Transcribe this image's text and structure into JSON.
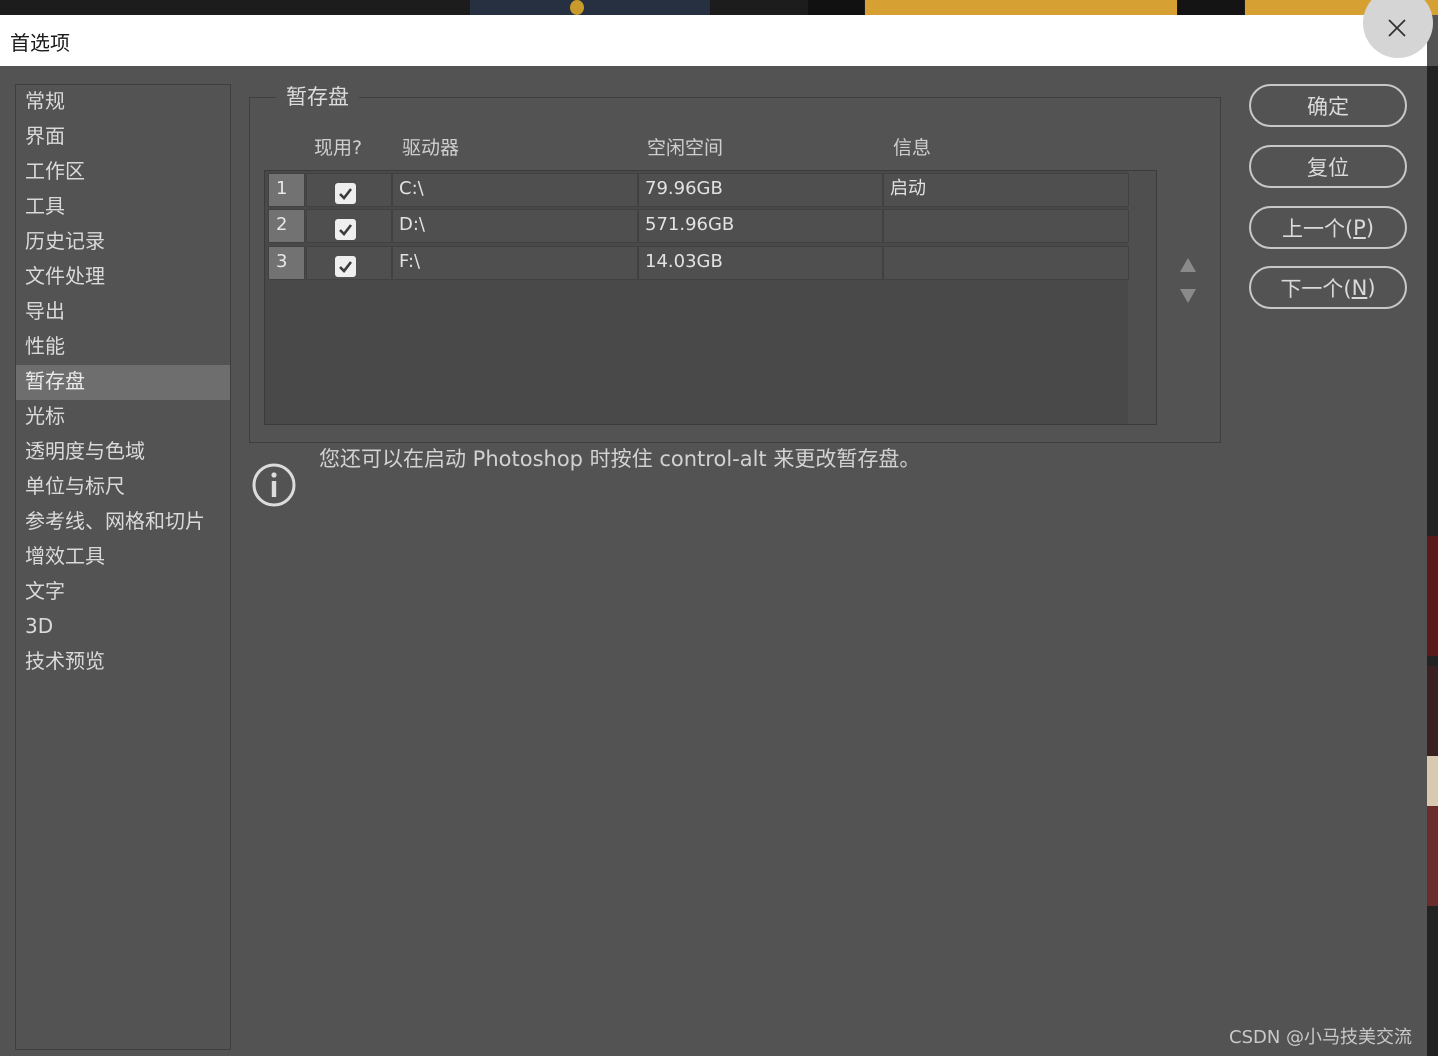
{
  "window": {
    "title": "首选项"
  },
  "sidebar": {
    "items": [
      {
        "label": "常规"
      },
      {
        "label": "界面"
      },
      {
        "label": "工作区"
      },
      {
        "label": "工具"
      },
      {
        "label": "历史记录"
      },
      {
        "label": "文件处理"
      },
      {
        "label": "导出"
      },
      {
        "label": "性能"
      },
      {
        "label": "暂存盘",
        "selected": true
      },
      {
        "label": "光标"
      },
      {
        "label": "透明度与色域"
      },
      {
        "label": "单位与标尺"
      },
      {
        "label": "参考线、网格和切片"
      },
      {
        "label": "增效工具"
      },
      {
        "label": "文字"
      },
      {
        "label": "3D"
      },
      {
        "label": "技术预览"
      }
    ]
  },
  "scratch": {
    "section_title": "暂存盘",
    "columns": {
      "active": "现用?",
      "drive": "驱动器",
      "free": "空闲空间",
      "info": "信息"
    },
    "rows": [
      {
        "num": "1",
        "checked": true,
        "drive": "C:\\",
        "free": "79.96GB",
        "info": "启动"
      },
      {
        "num": "2",
        "checked": true,
        "drive": "D:\\",
        "free": "571.96GB",
        "info": ""
      },
      {
        "num": "3",
        "checked": true,
        "drive": "F:\\",
        "free": "14.03GB",
        "info": ""
      }
    ]
  },
  "info": {
    "text": "您还可以在启动 Photoshop 时按住 control-alt 来更改暂存盘。"
  },
  "buttons": {
    "ok": "确定",
    "reset": "复位",
    "prev_text": "上一个(",
    "prev_key": "P",
    "next_text": "下一个(",
    "next_key": "N",
    "close_paren": ")"
  },
  "watermark": "CSDN @小马技美交流",
  "colors": {
    "background": "#535353",
    "selected": "#6e6e6e",
    "titlebar": "#ffffff"
  },
  "icons": [
    "close-icon",
    "checkmark-icon",
    "move-up-icon",
    "move-down-icon",
    "info-icon"
  ]
}
